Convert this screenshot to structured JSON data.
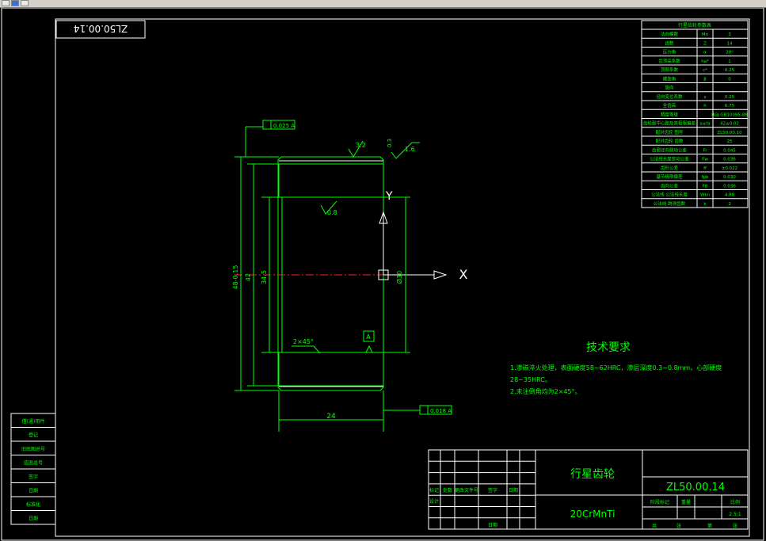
{
  "drawing_number": "ZL50.00.14",
  "drawing_number_mirrored": "ZL50.00.14",
  "part_name": "行星齿轮",
  "material": "20CrMnTi",
  "dimensions": {
    "length": "24",
    "outer_dia": "48-0.15",
    "inner_dia": "42",
    "bore_dia": "34.5",
    "bore_dia_right": "Ø30",
    "chamfer": "2×45°",
    "roughness_top": "3.2",
    "roughness_right": "1.6",
    "roughness_flank": "0.8",
    "runout_top": "0.025 A",
    "runout_bottom": "0.018 A",
    "tol_small": "0.3",
    "datum": "A",
    "axis_label_x": "X",
    "axis_label_y": "Y"
  },
  "tech_req": {
    "title": "技术要求",
    "line1": "1.渗碳淬火处理，表面硬度58~62HRC，渗层深度0.3~0.8mm，心部硬度",
    "line2": "28~35HRC。",
    "line3": "2.未注倒角均为2×45°。"
  },
  "param_table": {
    "title": "行星齿轮参数表",
    "rows": [
      [
        "法向模数",
        "Mn",
        "3"
      ],
      [
        "齿数",
        "Z",
        "14"
      ],
      [
        "压力角",
        "α",
        "20°"
      ],
      [
        "齿顶高系数",
        "ha*",
        "1"
      ],
      [
        "顶隙系数",
        "c*",
        "0.25"
      ],
      [
        "螺旋角",
        "β",
        "0"
      ],
      [
        "旋向",
        "",
        ""
      ],
      [
        "径向变位系数",
        "x",
        "0.25"
      ],
      [
        "全齿高",
        "h",
        "6.75"
      ],
      [
        "精度等级",
        "",
        "8GJ GB10095-88"
      ],
      [
        "齿轮副中心距及其极限偏差",
        "a±fa",
        "42±0.02"
      ],
      [
        "配对齿轮 图号",
        "",
        "ZL50.00.10"
      ],
      [
        "配对齿轮 齿数",
        "",
        "25"
      ],
      [
        "齿圈径向跳动公差",
        "Fr",
        "0.045"
      ],
      [
        "公法线长度变动公差",
        "Fw",
        "0.036"
      ],
      [
        "齿形公差",
        "ff",
        "±0.022"
      ],
      [
        "基节极限偏差",
        "fpb",
        "0.030"
      ],
      [
        "齿向公差",
        "Fβ",
        "0.036"
      ],
      [
        "公法线 公法线长度",
        "Wkn",
        "4.88"
      ],
      [
        "公法线 跨测齿数",
        "k",
        "2"
      ]
    ]
  },
  "left_strip": [
    "借(通)用件",
    "登记",
    "旧底图总号",
    "底图总号",
    "签字",
    "日期",
    "标准化",
    "日期"
  ],
  "title_block": {
    "headers": [
      "标记",
      "处数",
      "更改文件号",
      "签字",
      "日期"
    ],
    "design": "设计",
    "date": "日期",
    "stage": "阶段标记",
    "weight": "重量",
    "scale": "比例",
    "scale_val": "2.5:1",
    "sheets": "共",
    "sheet": "张",
    "page": "第",
    "page2": "张"
  },
  "colors": {
    "frame": "#ffffff",
    "geometry": "#00ff00",
    "centerline": "#ff2020",
    "background": "#000000"
  }
}
